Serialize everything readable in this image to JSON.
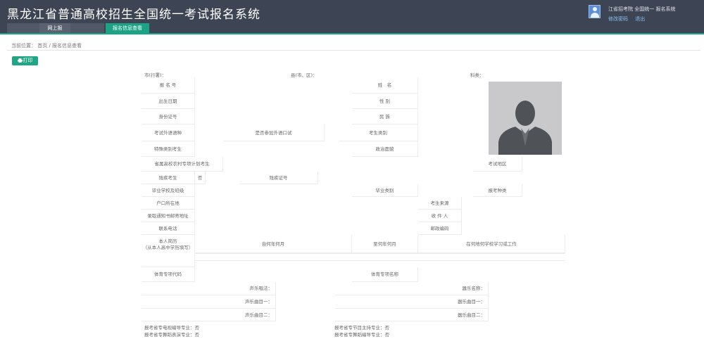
{
  "header": {
    "app_title": "黑龙江省普通高校招生全国统一考试报名系统",
    "user_name": "江省招考院 全国统一 报名系统",
    "links": [
      "修改密码",
      "退出"
    ]
  },
  "tabs": [
    "",
    "网上报",
    "",
    "报名信息查看"
  ],
  "breadcrumb": "当前位置： 首页 / 报名信息查看",
  "print_button": "打印",
  "top_labels": {
    "city": "市(行署)：",
    "county": "县(市、区)：",
    "subject": "科类："
  },
  "form": {
    "bmh": "报 名 号",
    "xm": "姓　名",
    "csrq": "出生日期",
    "xb": "性 别",
    "sfzh": "身份证号",
    "mz": "民 族",
    "wyyz": "考试外语语种",
    "kysfcj": "是否参加外语口试",
    "kslb": "考生类别",
    "tslb": "特殊类别考生",
    "zzmm": "政治面貌",
    "ncjh": "省属高校农村专项计划考生",
    "ksdq": "考试地区",
    "tyks": "残疾考生",
    "tyks_val": "否",
    "cjzh": "残疾证号",
    "byxx": "毕业学校及班级",
    "bylb": "毕业类别",
    "wyzl": "报考种类",
    "hkszd": "户口所在地",
    "kslx": "考生来源",
    "lqtzs": "录取通知书邮寄地址",
    "sjr": "收 件 人",
    "lxdh": "联系电话",
    "yzbm": "邮政编码",
    "jl_title": "本人简历",
    "jl_note": "（从本人高中学历填写）",
    "jl_from": "自何年何月",
    "jl_to": "至何年何月",
    "jl_where": "在何地何学校学习或工作",
    "tyzx_code": "体育专项代码",
    "tyzx_name": "体育专项名称",
    "sycd": "声乐唱法：",
    "qymc": "器乐名称：",
    "sy1": "声乐曲目一：",
    "qy1": "器乐曲目一：",
    "sy2": "声乐曲目二：",
    "qy2": "器乐曲目二："
  },
  "footer": {
    "l1": "报考省专电视编导专业：否",
    "l2": "报考省专舞蹈表演专业：否",
    "r1": "报考省专节目主持专业：否",
    "r2": "报考省专舞蹈编导专业：否"
  },
  "colors": {
    "header_bg": "#3d4454",
    "accent": "#1ca386",
    "photo_bg": "#c9c9cb",
    "avatar_silhouette": "#4f5357"
  }
}
